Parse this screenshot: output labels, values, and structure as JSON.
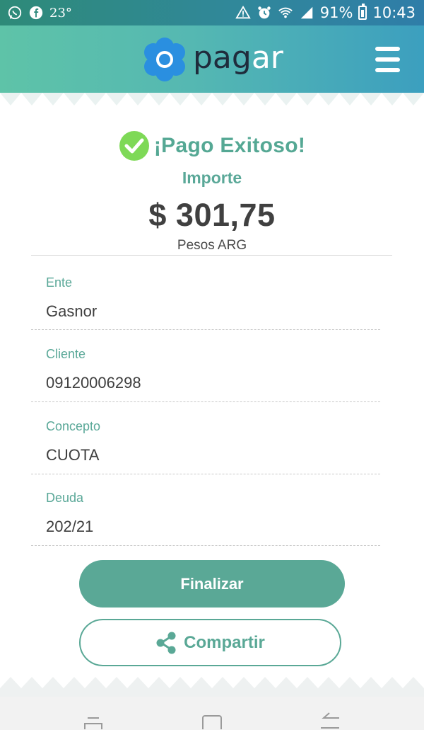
{
  "status_bar": {
    "temperature": "23°",
    "battery": "91%",
    "time": "10:43",
    "icons": [
      "whatsapp-icon",
      "facebook-icon",
      "warning-icon",
      "alarm-icon",
      "wifi-icon",
      "signal-icon",
      "battery-icon"
    ]
  },
  "header": {
    "logo_text_dark": "pag",
    "logo_text_light": "ar",
    "menu_icon": "hamburger-menu-icon"
  },
  "receipt": {
    "status_title": "¡Pago Exitoso!",
    "amount_label": "Importe",
    "amount": "$ 301,75",
    "currency": "Pesos ARG",
    "fields": [
      {
        "label": "Ente",
        "value": "Gasnor"
      },
      {
        "label": "Cliente",
        "value": "09120006298"
      },
      {
        "label": "Concepto",
        "value": "CUOTA"
      },
      {
        "label": "Deuda",
        "value": "202/21"
      }
    ]
  },
  "actions": {
    "finish_label": "Finalizar",
    "share_label": "Compartir"
  },
  "colors": {
    "accent": "#5aa896",
    "header_start": "#5ec3a8",
    "header_end": "#3c9fbf",
    "success": "#7ed957",
    "logo_blue": "#2a8fe0"
  }
}
